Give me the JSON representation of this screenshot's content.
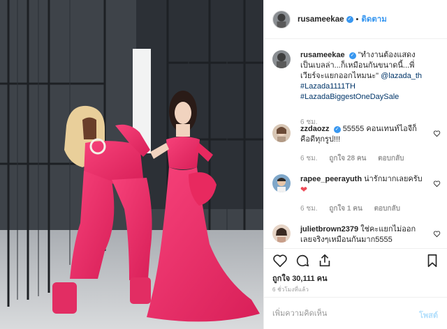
{
  "post": {
    "username": "rusameekae",
    "follow_label": "ติดตาม",
    "separator": "•",
    "caption_quote": "\"ทำงานต้องแสดงเป็นเบลล่า...ก็เหมือนกันขนาดนี้...พี่เวียร์จะแยกออกไหมนะ\"",
    "caption_mention": "@lazada_th",
    "caption_tag_1": "#Lazada1111TH",
    "caption_tag_2": "#LazadaBiggestOneDaySale",
    "caption_time": "6 ชม."
  },
  "comments": [
    {
      "user": "zzdaozz",
      "text": "55555 คอนเทนท์ไอจีก็คือดีทุกรูป!!!",
      "time": "6 ชม.",
      "likes": "ถูกใจ 28 คน",
      "reply": "ตอบกลับ"
    },
    {
      "user": "rapee_peerayuth",
      "text": "น่ารักมากเลยครับ",
      "emoji": "❤",
      "time": "6 ชม.",
      "likes": "ถูกใจ 1 คน",
      "reply": "ตอบกลับ"
    },
    {
      "user": "julietbrown2379",
      "text": "ใช่คะแยกไม่ออกเลยจริงๆเหมือนกันมาก5555"
    }
  ],
  "stats": {
    "likes": "ถูกใจ 30,111 คน",
    "posted": "6 ชั่วโมงที่แล้ว"
  },
  "composer": {
    "placeholder": "เพิ่มความคิดเห็น",
    "post_label": "โพสต์"
  },
  "icons": {
    "verified": "verified-badge-icon",
    "like": "heart-icon",
    "comment": "comment-icon",
    "share": "share-icon",
    "save": "bookmark-icon"
  },
  "colors": {
    "accent": "#3897f0",
    "link": "#003569",
    "muted": "#999999",
    "outfit_pink": "#f0306a",
    "heart_red": "#ed4956"
  }
}
